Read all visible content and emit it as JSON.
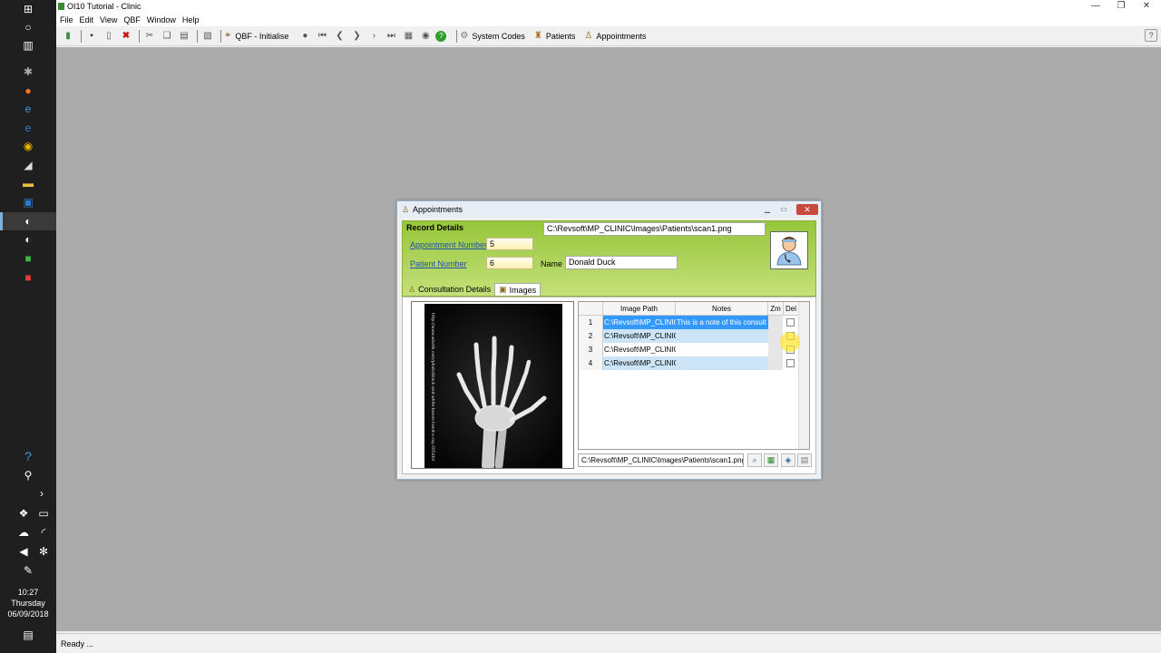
{
  "window": {
    "title": "OI10 Tutorial - Clinic"
  },
  "menu": [
    "File",
    "Edit",
    "View",
    "QBF",
    "Window",
    "Help"
  ],
  "toolbar": {
    "qbf_label": "QBF - Initialise",
    "system_codes": "System Codes",
    "patients": "Patients",
    "appointments": "Appointments"
  },
  "status": {
    "text": "Ready ..."
  },
  "clock": {
    "time": "10:27",
    "day": "Thursday",
    "date": "06/09/2018"
  },
  "dialog": {
    "title": "Appointments",
    "record_details": "Record Details",
    "image_path_display": "C:\\Revsoft\\MP_CLINIC\\Images\\Patients\\scan1.png",
    "appointment_number_label": "Appointment Number",
    "appointment_number": "5",
    "patient_number_label": "Patient Number",
    "patient_number": "6",
    "name_label": "Name",
    "name": "Donald Duck",
    "tabs": [
      "Consultation Details",
      "Images"
    ],
    "xray_caption": "http://www.wisetk.com/photo/black-and-white-bones-hand-x-ray-2054hi/",
    "grid": {
      "headers": [
        "Image Path",
        "Notes",
        "Zm",
        "Del"
      ],
      "rows": [
        {
          "num": "1",
          "path": "C:\\Revsoft\\MP_CLINIC\\",
          "notes": "This is a note of this consult"
        },
        {
          "num": "2",
          "path": "C:\\Revsoft\\MP_CLINIC\\",
          "notes": ""
        },
        {
          "num": "3",
          "path": "C:\\Revsoft\\MP_CLINIC\\",
          "notes": ""
        },
        {
          "num": "4",
          "path": "C:\\Revsoft\\MP_CLINIC\\",
          "notes": ""
        }
      ]
    },
    "path_field": "C:\\Revsoft\\MP_CLINIC\\Images\\Patients\\scan1.png"
  },
  "colors": {
    "selection": "#3399ff",
    "row_alt": "#cce4f7",
    "record_green": "#a8d050"
  }
}
